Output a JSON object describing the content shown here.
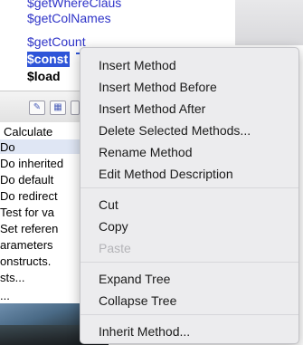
{
  "method_list": {
    "items": [
      "$getWhereClaus",
      "$getColNames",
      "$getCount",
      "$const",
      "$load"
    ],
    "selected_index": 3
  },
  "toolbar": {
    "icons": [
      "edit-icon",
      "table-icon",
      "partial-icon"
    ]
  },
  "tree_list": {
    "rows": [
      "Calculate",
      "Do",
      "Do inherited",
      "Do default",
      "Do redirect",
      "Test for va",
      "Set referen",
      "arameters",
      "onstructs.",
      "sts...",
      "..."
    ]
  },
  "context_menu": {
    "groups": [
      [
        "Insert Method",
        "Insert Method Before",
        "Insert Method After",
        "Delete Selected Methods...",
        "Rename Method",
        "Edit Method Description"
      ],
      [
        "Cut",
        "Copy",
        "Paste"
      ],
      [
        "Expand Tree",
        "Collapse Tree"
      ],
      [
        "Inherit Method..."
      ]
    ],
    "disabled": [
      "Paste"
    ]
  },
  "colors": {
    "method_text": "#2f34c8",
    "selection": "#2f55d8",
    "menu_bg": "#ececee",
    "disabled_text": "#b4b4b8"
  }
}
